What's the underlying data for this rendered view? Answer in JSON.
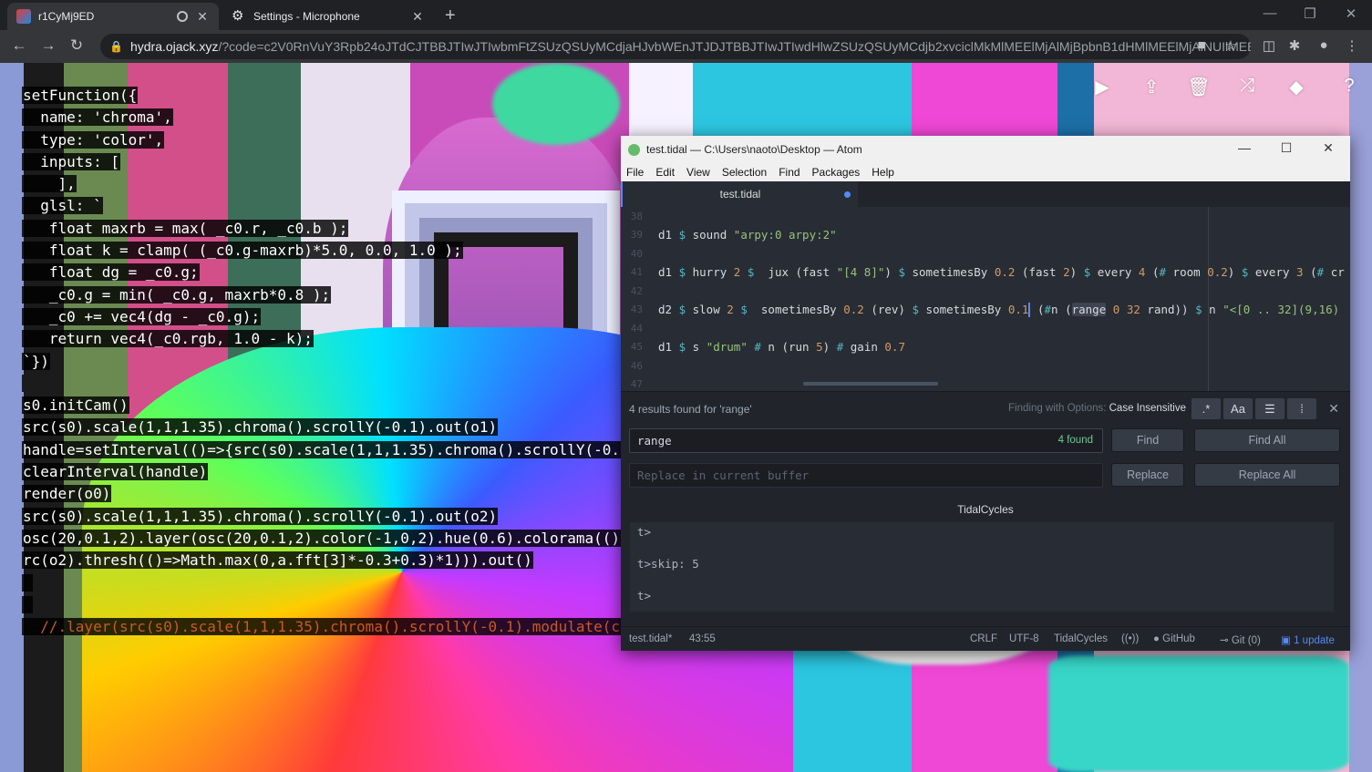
{
  "browser": {
    "tabs": [
      {
        "title": "r1CyMj9ED",
        "active": true
      },
      {
        "title": "Settings - Microphone",
        "active": false
      }
    ],
    "url_host": "hydra.ojack.xyz",
    "url_path": "/?code=c2V0RnVuY3Rpb24oJTdCJTBBJTIwJTIwbmFtZSUzQSUyMCdjaHJvbWEnJTJDJTBBJTIwJTIwdHlwZSUzQSUyMCdjb2xvciclMkMlMEElMjAlMjBpbnB1dHMlMEElMjAlNUIlMEEl..."
  },
  "hydra": {
    "code_lines": [
      "setFunction({",
      "  name: 'chroma',",
      "  type: 'color',",
      "  inputs: [",
      "    ],",
      "  glsl: `",
      "   float maxrb = max( _c0.r, _c0.b );",
      "   float k = clamp( (_c0.g-maxrb)*5.0, 0.0, 1.0 );",
      "   float dg = _c0.g;",
      "   _c0.g = min( _c0.g, maxrb*0.8 );",
      "   _c0 += vec4(dg - _c0.g);",
      "   return vec4(_c0.rgb, 1.0 - k);",
      "`})",
      "",
      "s0.initCam()",
      "src(s0).scale(1,1,1.35).chroma().scrollY(-0.1).out(o1)",
      "handle=setInterval(()=>{src(s0).scale(1,1,1.35).chroma().scrollY(-0.",
      "clearInterval(handle)",
      "render(o0)",
      "src(s0).scale(1,1,1.35).chroma().scrollY(-0.1).out(o2)",
      "osc(20,0.1,2).layer(osc(20,0.1,2).color(-1,0,2).hue(0.6).colorama(()",
      "rc(o2).thresh(()=>Math.max(0,a.fft[3]*-0.3+0.3)*1))).out()",
      " ",
      " ",
      "  //.layer(src(s0).scale(1,1,1.35).chroma().scrollY(-0.1).modulate(c"
    ]
  },
  "atom": {
    "title": "test.tidal — C:\\Users\\naoto\\Desktop — Atom",
    "menu": [
      "File",
      "Edit",
      "View",
      "Selection",
      "Find",
      "Packages",
      "Help"
    ],
    "tab": "test.tidal",
    "gutter": [
      "38",
      "39",
      "40",
      "41",
      "42",
      "43",
      "44",
      "45",
      "46",
      "47"
    ],
    "find": {
      "summary": "4 results found for 'range'",
      "options_label": "Finding with Options:",
      "options_value": "Case Insensitive",
      "query": "range",
      "count": "4 found",
      "replace_placeholder": "Replace in current buffer",
      "find_btn": "Find",
      "find_all_btn": "Find All",
      "replace_btn": "Replace",
      "replace_all_btn": "Replace All",
      "aa_label": "Aa"
    },
    "tidal": {
      "title": "TidalCycles",
      "lines": [
        "t>",
        "t>skip: 5",
        "t>"
      ]
    },
    "status": {
      "file": "test.tidal*",
      "cursor": "43:55",
      "line_ending": "CRLF",
      "encoding": "UTF-8",
      "grammar": "TidalCycles",
      "github": "GitHub",
      "git": "Git (0)",
      "update": "1 update"
    }
  },
  "colors": {
    "accent": "#568af2",
    "tidal_string": "#98c379",
    "tidal_number": "#d19a66",
    "tidal_operator": "#56b6c2"
  }
}
